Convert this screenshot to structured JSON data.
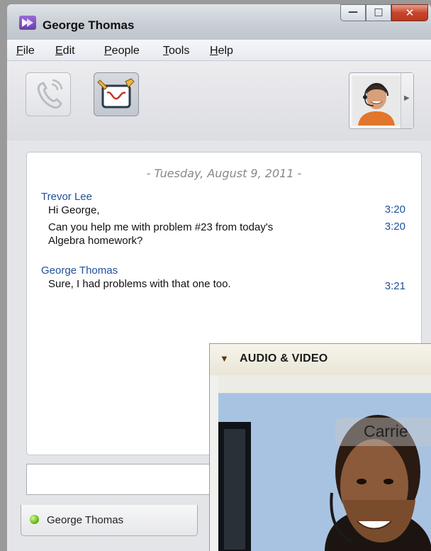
{
  "window": {
    "title": "George Thomas"
  },
  "menu": [
    {
      "label": "File",
      "accel": "F",
      "rest": "ile"
    },
    {
      "label": "Edit",
      "accel": "E",
      "rest": "dit"
    },
    {
      "label": "People",
      "accel": "P",
      "rest": "eople"
    },
    {
      "label": "Tools",
      "accel": "T",
      "rest": "ools"
    },
    {
      "label": "Help",
      "accel": "H",
      "rest": "elp"
    }
  ],
  "toolbar": {
    "call_icon": "phone-icon",
    "whiteboard_icon": "whiteboard-icon",
    "contact_photo_icon": "contact-avatar-icon"
  },
  "chat": {
    "date_line": "- Tuesday, August 9, 2011 -",
    "groups": [
      {
        "sender": "Trevor Lee",
        "messages": [
          {
            "text": "Hi George,",
            "time": "3:20"
          },
          {
            "text": "Can you help me with problem #23 from today's",
            "text2": "Algebra homework?",
            "time": "3:20"
          }
        ]
      },
      {
        "sender": "George Thomas",
        "messages": [
          {
            "text": "Sure, I had problems with that one too.",
            "time": "3:21"
          }
        ]
      }
    ]
  },
  "tab": {
    "label": "George Thomas",
    "status": "online"
  },
  "av_panel": {
    "title": "AUDIO & VIDEO",
    "caller_name": "Carrie"
  },
  "colors": {
    "link_blue": "#1f4f9a",
    "status_green": "#6fc21d",
    "close_red": "#c8452c"
  }
}
